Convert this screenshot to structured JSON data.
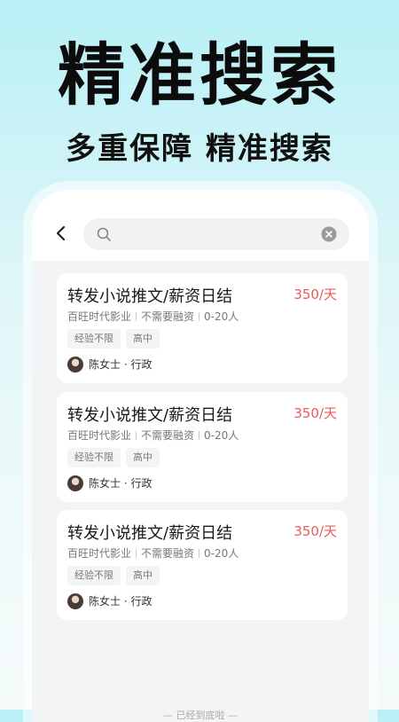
{
  "hero": {
    "title": "精准搜索",
    "subtitle": "多重保障 精准搜索"
  },
  "search": {
    "back_icon": "chevron-left-icon",
    "search_icon": "search-icon",
    "clear_icon": "clear-icon"
  },
  "jobs": [
    {
      "title": "转发小说推文/薪资日结",
      "salary": "350/天",
      "company": "百旺时代影业",
      "funding": "不需要融资",
      "size": "0-20人",
      "tags": [
        "经验不限",
        "高中"
      ],
      "recruiter": "陈女士 · 行政"
    },
    {
      "title": "转发小说推文/薪资日结",
      "salary": "350/天",
      "company": "百旺时代影业",
      "funding": "不需要融资",
      "size": "0-20人",
      "tags": [
        "经验不限",
        "高中"
      ],
      "recruiter": "陈女士 · 行政"
    },
    {
      "title": "转发小说推文/薪资日结",
      "salary": "350/天",
      "company": "百旺时代影业",
      "funding": "不需要融资",
      "size": "0-20人",
      "tags": [
        "经验不限",
        "高中"
      ],
      "recruiter": "陈女士 · 行政"
    }
  ],
  "list_end": "— 已经到底啦 —",
  "colors": {
    "salary": "#ec5a58",
    "list_bg": "#f3f4f6"
  }
}
